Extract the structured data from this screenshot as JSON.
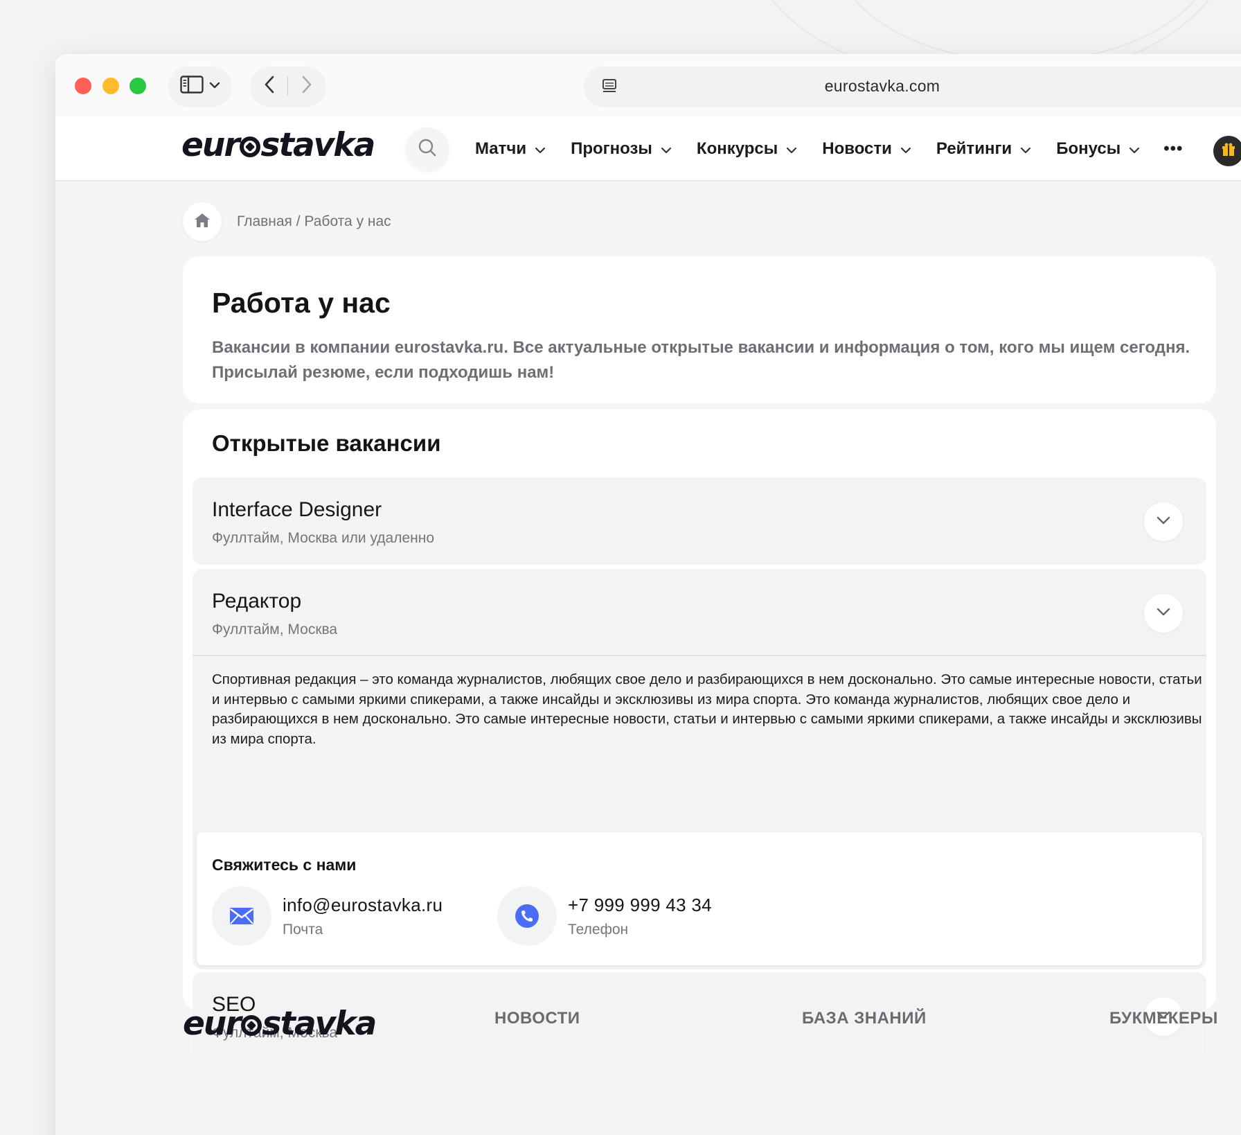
{
  "browser": {
    "url": "eurostavka.com"
  },
  "site": {
    "logo_text": "eurostavka",
    "nav": [
      {
        "label": "Матчи"
      },
      {
        "label": "Прогнозы"
      },
      {
        "label": "Конкурсы"
      },
      {
        "label": "Новости"
      },
      {
        "label": "Рейтинги"
      },
      {
        "label": "Бонусы"
      }
    ],
    "more_label": "•••"
  },
  "breadcrumb": {
    "text": "Главная / Работа у нас"
  },
  "intro": {
    "title": "Работа у нас",
    "description": "Вакансии в компании eurostavka.ru. Все актуальные открытые вакансии и информация о том, кого мы ищем сегодня. Присылай резюме, если подходишь нам!"
  },
  "vacancies": {
    "section_title": "Открытые вакансии",
    "items": [
      {
        "title": "Interface Designer",
        "subtitle": "Фуллтайм, Москва или удаленно"
      },
      {
        "title": "Редактор",
        "subtitle": "Фуллтайм, Москва"
      },
      {
        "title": "SEO",
        "subtitle": "Фуллтайм, Москва"
      }
    ],
    "expanded_body": "Спортивная редакция – это команда журналистов, любящих свое дело и разбирающихся в нем досконально. Это самые интересные новости, статьи и интервью с самыми яркими спикерами, а также инсайды и эксклюзивы из мира спорта. Это команда журналистов, любящих свое дело и разбирающихся в нем досконально. Это самые интересные новости, статьи и интервью с самыми яркими спикерами, а также инсайды и эксклюзивы из мира спорта."
  },
  "contact": {
    "title": "Свяжитесь с нами",
    "email": {
      "value": "info@eurostavka.ru",
      "label": "Почта",
      "icon": "mail-icon"
    },
    "phone": {
      "value": "+7 999 999 43 34",
      "label": "Телефон",
      "icon": "phone-icon"
    }
  },
  "footer": {
    "links": [
      {
        "label": "НОВОСТИ"
      },
      {
        "label": "БАЗА ЗНАНИЙ"
      },
      {
        "label": "БУКМЕКЕРЫ"
      }
    ]
  },
  "colors": {
    "accent": "#4a6cf7",
    "text_dark": "#141414",
    "text_muted": "#72767b"
  }
}
